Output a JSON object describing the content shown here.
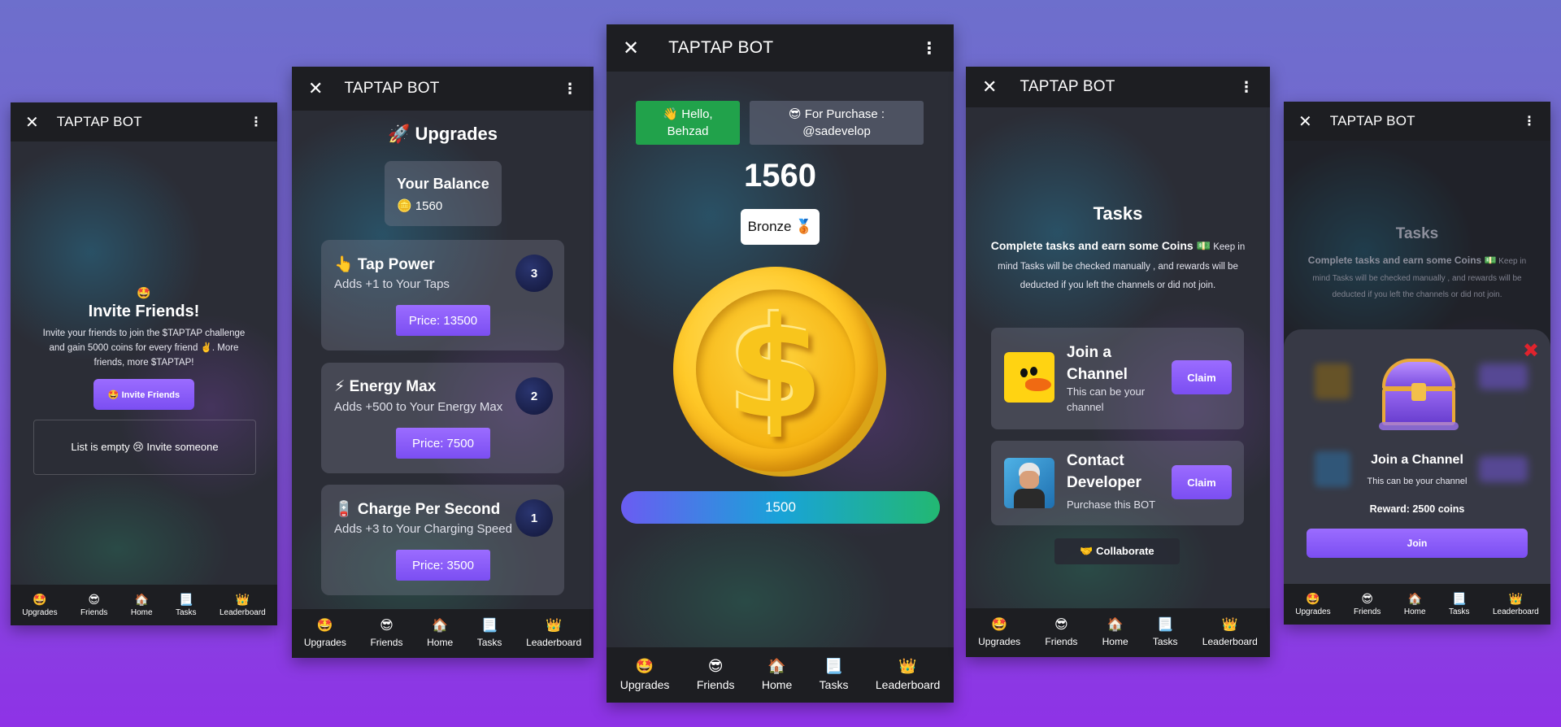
{
  "app": {
    "title": "TAPTAP BOT",
    "close_glyph": "✕",
    "menu_glyph": "⋮"
  },
  "nav": [
    {
      "icon": "🤩",
      "icon_name": "star-struck-icon",
      "label": "Upgrades"
    },
    {
      "icon": "😎",
      "icon_name": "sunglasses-icon",
      "label": "Friends"
    },
    {
      "icon": "🏠",
      "icon_name": "house-icon",
      "label": "Home"
    },
    {
      "icon": "📃",
      "icon_name": "page-icon",
      "label": "Tasks"
    },
    {
      "icon": "👑",
      "icon_name": "crown-icon",
      "label": "Leaderboard"
    }
  ],
  "friends": {
    "emoji": "🤩",
    "title": "Invite Friends!",
    "description": "Invite your friends to join the $TAPTAP challenge and gain 5000 coins for every friend ✌️. More friends, more $TAPTAP!",
    "invite_button": "🤩 Invite Friends",
    "empty_text": "List is empty 😢 Invite someone"
  },
  "upgrades": {
    "title": "🚀 Upgrades",
    "balance_label": "Your Balance",
    "balance_value": "🪙 1560",
    "items": [
      {
        "title": "👆 Tap Power",
        "desc": "Adds +1 to Your Taps",
        "level": "3",
        "price": "Price: 13500"
      },
      {
        "title": "⚡ Energy Max",
        "desc": "Adds +500 to Your Energy Max",
        "level": "2",
        "price": "Price: 7500"
      },
      {
        "title": "🪫 Charge Per Second",
        "desc": "Adds +3 to Your Charging Speed",
        "level": "1",
        "price": "Price: 3500"
      }
    ]
  },
  "home": {
    "hello": "👋 Hello, Behzad",
    "purchase": "😎 For Purchase : @sadevelop",
    "score": "1560",
    "rank": "Bronze 🥉",
    "coin_symbol": "$",
    "energy": "1500",
    "energy_fraction": 1.0,
    "colors": {
      "hello": "#21a24b",
      "energy_start": "#6a5cf2",
      "energy_mid": "#19a3d8",
      "energy_end": "#22b872"
    }
  },
  "tasks": {
    "title": "Tasks",
    "intro_bold": "Complete tasks and earn some Coins 💵",
    "intro_rest": " Keep in mind Tasks will be checked manually , and rewards will be deducted if you left the channels or did not join.",
    "items": [
      {
        "title": "Join a Channel",
        "desc": "This can be your channel",
        "claim": "Claim"
      },
      {
        "title": "Contact Developer",
        "desc": "Purchase this BOT",
        "claim": "Claim"
      }
    ],
    "collaborate": "🤝 Collaborate"
  },
  "modal": {
    "title": "Join a Channel",
    "desc": "This can be your channel",
    "reward": "Reward: 2500 coins",
    "join_button": "Join",
    "close_glyph": "✖"
  }
}
